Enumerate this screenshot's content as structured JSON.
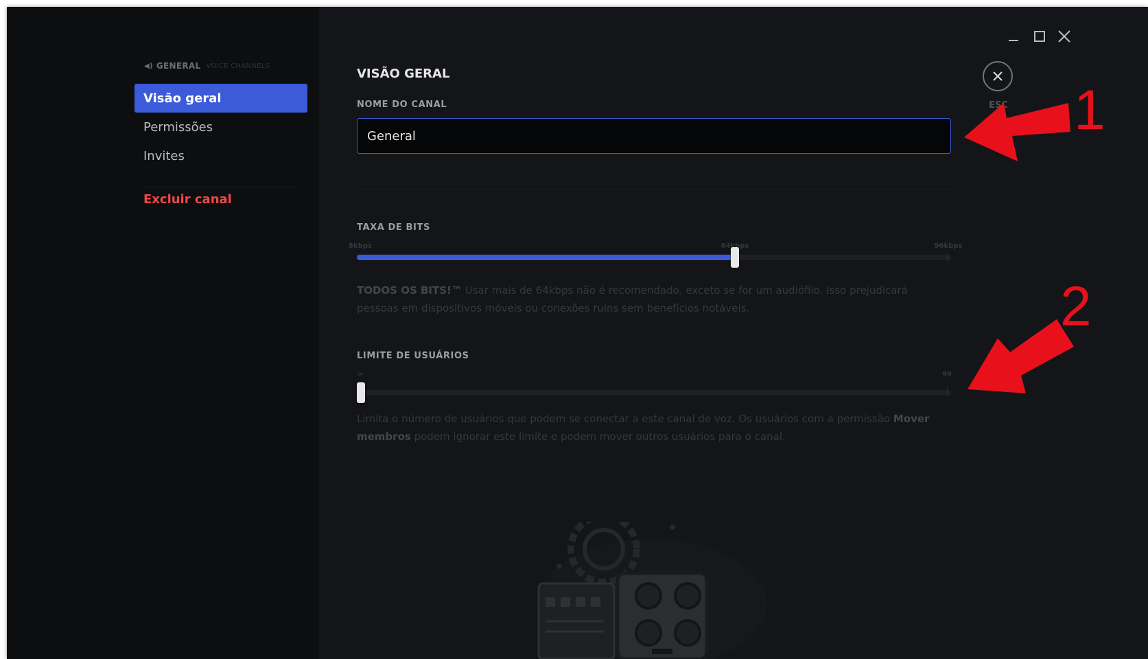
{
  "window_controls": {
    "minimize_icon": "minimize-icon",
    "maximize_icon": "maximize-icon",
    "close_icon": "close-icon"
  },
  "sidebar": {
    "header": {
      "icon": "speaker-icon",
      "channel": "GENERAL",
      "category": "VOICE CHANNELS"
    },
    "items": [
      {
        "label": "Visão geral",
        "active": true
      },
      {
        "label": "Permissões",
        "active": false
      },
      {
        "label": "Invites",
        "active": false
      }
    ],
    "danger_item": {
      "label": "Excluir canal",
      "color": "#f04747"
    }
  },
  "main": {
    "title": "VISÃO GERAL",
    "channel_name": {
      "label": "NOME DO CANAL",
      "value": "General"
    },
    "bitrate": {
      "label": "TAXA DE BITS",
      "min_label": "8kbps",
      "mid_label": "64kbps",
      "max_label": "96kbps",
      "min_value": 8,
      "max_value": 96,
      "current_value": 64,
      "helper_bold": "TODOS OS BITS!™",
      "helper_text": " Usar mais de 64kbps não é recomendado, exceto se for um audiófilo. Isso prejudicará pessoas em dispositivos móveis ou conexões ruins sem benefícios notáveis."
    },
    "user_limit": {
      "label": "LIMITE DE USUÁRIOS",
      "min_label": "∞",
      "max_label": "99",
      "min_value": 0,
      "max_value": 99,
      "current_value": 0,
      "helper_text_1": "Limita o número de usuários que podem se conectar a este canal de voz. Os usuários com a permissão ",
      "helper_bold": "Mover membros",
      "helper_text_2": " podem ignorar este limite e podem mover outros usuários para o canal."
    },
    "close_button": {
      "icon": "close-icon",
      "label": "ESC"
    }
  },
  "annotations": {
    "numbers": [
      "1",
      "2"
    ],
    "color": "#e8111b"
  },
  "colors": {
    "accent": "#3b5bd9",
    "background": "#141518",
    "sidebar": "#0d0e10",
    "danger": "#f04747"
  }
}
